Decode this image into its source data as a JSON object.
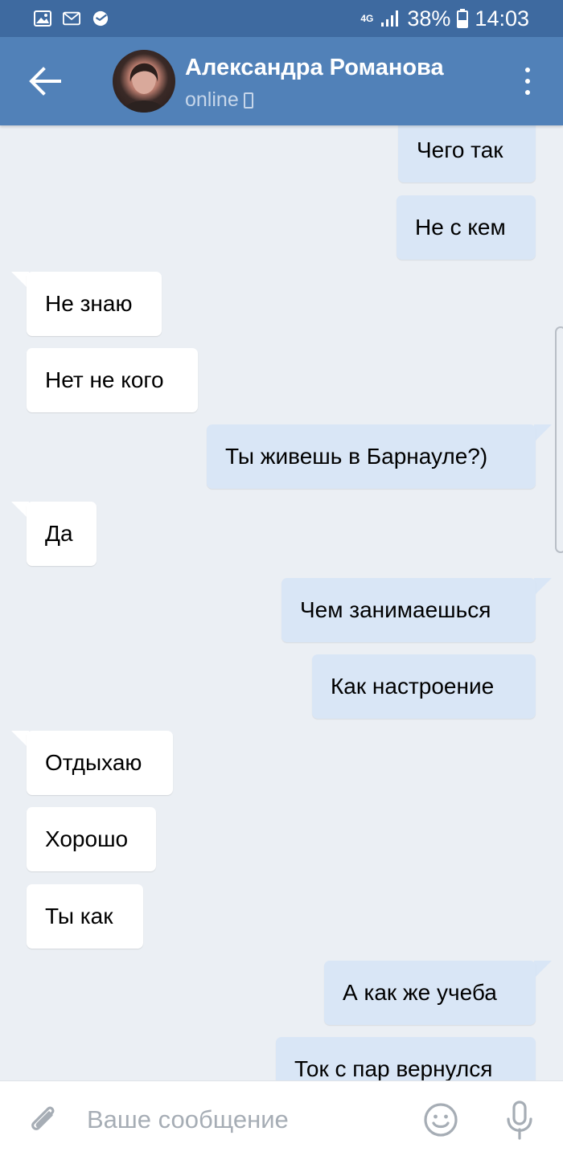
{
  "status_bar": {
    "network": "4G",
    "battery": "38%",
    "time": "14:03",
    "icons": [
      "gallery-icon",
      "mail-icon",
      "sberbank-icon",
      "signal-icon",
      "battery-icon"
    ]
  },
  "header": {
    "contact_name": "Александра Романова",
    "status": "online",
    "icons": [
      "back-arrow-icon",
      "avatar",
      "mobile-icon",
      "more-vert-icon"
    ]
  },
  "messages": [
    {
      "dir": "out",
      "text": "Чего так"
    },
    {
      "dir": "out",
      "text": "Не с кем"
    },
    {
      "dir": "in",
      "text": "Не знаю"
    },
    {
      "dir": "in",
      "text": "Нет не кого"
    },
    {
      "dir": "out",
      "text": "Ты живешь в Барнауле?)"
    },
    {
      "dir": "in",
      "text": "Да"
    },
    {
      "dir": "out",
      "text": "Чем занимаешься"
    },
    {
      "dir": "out",
      "text": "Как настроение"
    },
    {
      "dir": "in",
      "text": "Отдыхаю"
    },
    {
      "dir": "in",
      "text": "Хорошо"
    },
    {
      "dir": "in",
      "text": "Ты как"
    },
    {
      "dir": "out",
      "text": "А как же учеба"
    },
    {
      "dir": "out",
      "text": "Ток с пар вернулся"
    }
  ],
  "composer": {
    "placeholder": "Ваше сообщение",
    "value": "",
    "icons": [
      "paperclip-icon",
      "emoji-icon",
      "microphone-icon"
    ]
  },
  "colors": {
    "status_bar_bg": "#3e6aa0",
    "header_bg": "#5181b8",
    "chat_bg": "#ebeff4",
    "incoming_bubble": "#ffffff",
    "outgoing_bubble": "#d9e6f6"
  }
}
